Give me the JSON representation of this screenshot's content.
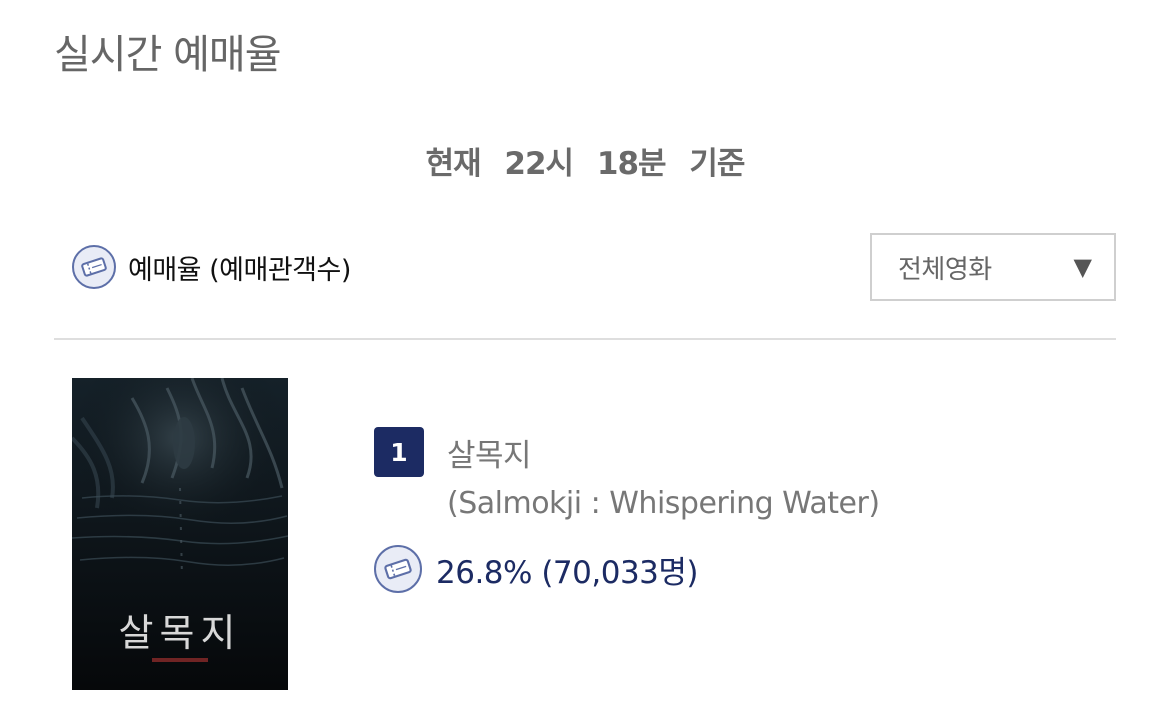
{
  "header": {
    "title": "실시간 예매율"
  },
  "timestamp": {
    "prefix": "현재",
    "hour": "22시",
    "minute": "18분",
    "suffix": "기준"
  },
  "metric": {
    "icon": "ticket-icon",
    "label": "예매율 (예매관객수)"
  },
  "filter": {
    "selected": "전체영화",
    "caret": "▼"
  },
  "movies": [
    {
      "rank": "1",
      "title_ko": "살목지",
      "title_en": "(Salmokji : Whispering Water)",
      "rate": "26.8% (70,033명)",
      "poster_title": "살목지"
    }
  ],
  "colors": {
    "accent": "#1c2b63",
    "muted_text": "#777777",
    "divider": "#dedede"
  }
}
